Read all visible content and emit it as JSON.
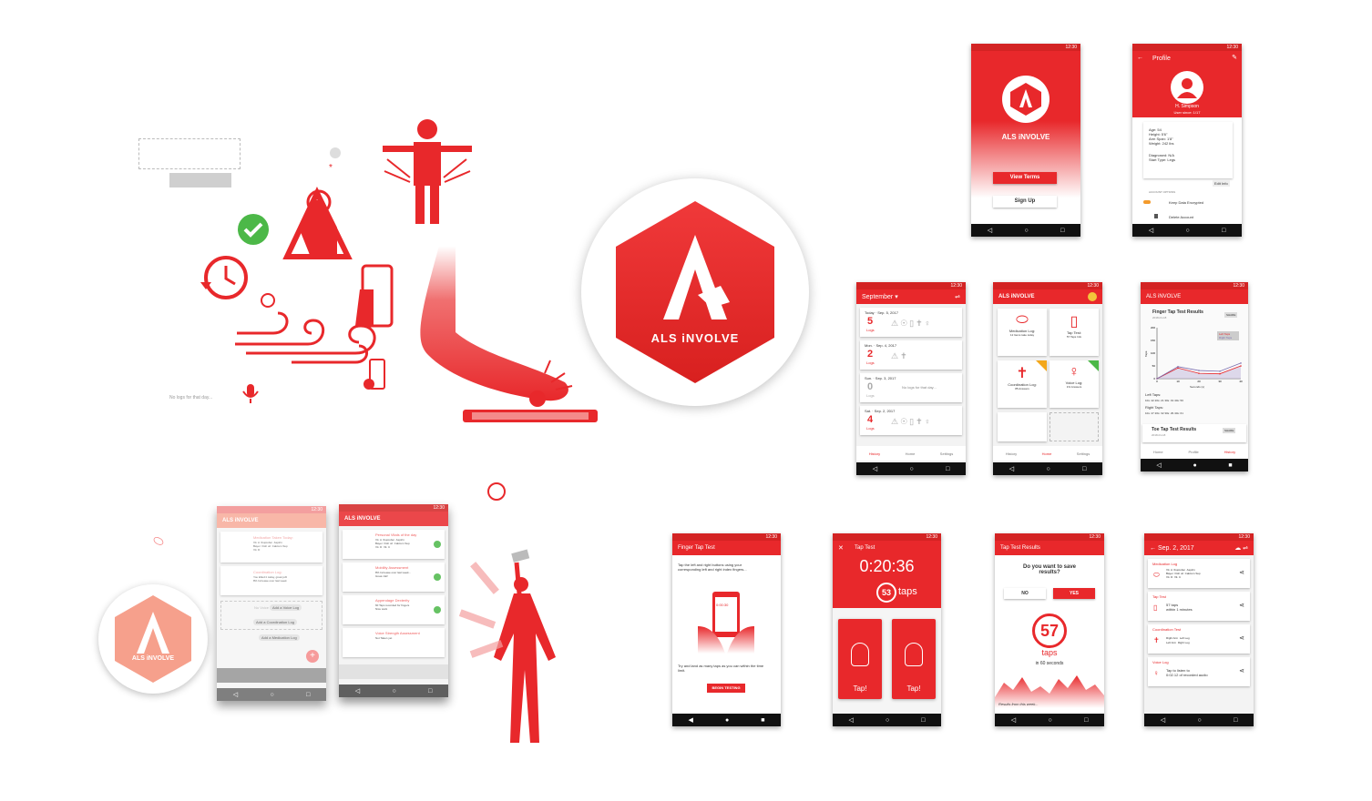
{
  "brand": {
    "name": "ALS iNVOLVE",
    "colors": {
      "primary": "#e8282b",
      "dark": "#c31f22",
      "faded": "#f4a08a"
    }
  },
  "status_time": "12:30",
  "left": {
    "no_logs": "No logs for that day..."
  },
  "splash": {
    "app_name": "ALS iNVOLVE",
    "view_terms": "View Terms",
    "sign_up": "Sign Up"
  },
  "profile": {
    "title": "Profile",
    "name": "H. Simpson",
    "user_since": "User since: 1/17",
    "details": [
      "Age: 54",
      "Height: 5'6\"",
      "Arm Span: 1'8\"",
      "Weight: 242 lbs"
    ],
    "diag": [
      "Diagnosed: N/A",
      "Start Type: Legs"
    ],
    "edit": "Edit Info",
    "account_options": "ACCOUNT OPTIONS",
    "encrypt": "Keep Data Encrypted",
    "delete": "Delete Account"
  },
  "history": {
    "month": "September",
    "days": [
      {
        "date": "Today · Sep. 5, 2017",
        "count": "5",
        "unit": "Logs"
      },
      {
        "date": "Mon. · Sep. 4, 2017",
        "count": "2",
        "unit": "Logs"
      },
      {
        "date": "Sun. · Sep. 3, 2017",
        "count": "0",
        "unit": "Logs",
        "note": "No logs for that day..."
      },
      {
        "date": "Sat. · Sep. 2, 2017",
        "count": "4",
        "unit": "Logs"
      }
    ],
    "nav": [
      "History",
      "Home",
      "Settings"
    ]
  },
  "home": {
    "title": "ALS iNVOLVE",
    "tiles": [
      {
        "label": "Medication Log:",
        "sub": "12 Items take today"
      },
      {
        "label": "Tap Test:",
        "sub": "57 Taps Info"
      },
      {
        "label": "Coordination Log:",
        "sub": "85 Answers"
      },
      {
        "label": "Voice Log:",
        "sub": "1% Answers"
      }
    ],
    "nav": [
      "History",
      "Home",
      "Settings"
    ]
  },
  "results": {
    "header": "ALS iNVOLVE",
    "title": "Finger Tap Test Results",
    "date": "2018-01-18",
    "share": "SHARE",
    "legend": [
      "Left Taps",
      "Right Taps"
    ],
    "xlabel": "Seconds (s)",
    "ylabel": "Taps",
    "left_label": "Left Taps:",
    "left_vals": "10s: 42  20s: 21  30s: 19  40s: 50",
    "right_label": "Right Taps:",
    "right_vals": "10s: 47  20s: 32  30s: 29  40s: 61",
    "toe_title": "Toe Tap Test Results",
    "toe_date": "2018-01-18",
    "nav": [
      "Home",
      "Profile",
      "History"
    ]
  },
  "chart_data": {
    "type": "line",
    "x": [
      0,
      10,
      20,
      30,
      40
    ],
    "xlim": [
      0,
      40
    ],
    "ylim": [
      0,
      200
    ],
    "series": [
      {
        "name": "Left Taps",
        "values": [
          0,
          42,
          21,
          19,
          50
        ]
      },
      {
        "name": "Right Taps",
        "values": [
          0,
          47,
          32,
          29,
          61
        ]
      }
    ]
  },
  "finger": {
    "title": "Finger Tap Test",
    "instructions": "Tap the left and right buttons using your corresponding left and right index fingers...",
    "timer": "0:00:30",
    "more": "Try and land as many taps as you can within the time limit.",
    "begin": "BEGIN TESTING"
  },
  "taptest": {
    "title": "Tap Test",
    "timer": "0:20:36",
    "count": "53",
    "unit": "taps",
    "left": "Tap!",
    "right": "Tap!"
  },
  "tapresults": {
    "title": "Tap Test Results",
    "question": "Do you want to save results?",
    "no": "NO",
    "yes": "YES",
    "count": "57",
    "unit": "taps",
    "time": "in 60 seconds",
    "footer": "Results from this week..."
  },
  "daylog": {
    "title": "Sep. 2, 2017",
    "items": [
      {
        "title": "Medication Log",
        "rows": "Vit. A  Ibuprofen  Aspirin\nBayer  Fish oil  Calcium Sup\nVit. D  Vit. C"
      },
      {
        "title": "Tap Test",
        "rows": "57 taps\nwithin 1 minutes"
      },
      {
        "title": "Coordination Test",
        "rows": "Right Arm  Left Leg\nLeft Arm  Right Leg"
      },
      {
        "title": "Voice Log",
        "rows": "Tap to listen to\n0:02.12 of recorded audio"
      }
    ]
  },
  "faded": {
    "brand": "ALS iNVOLVE",
    "home": {
      "title": "ALS iNVOLVE",
      "items": [
        {
          "title": "Medication Taken Today:",
          "rows": "Vit. A  Ibuprofen  Aspirin\nBayer  Fish oil  Calcium Sup\nVit. D"
        },
        {
          "title": "Coordination Log:",
          "rows": "You killed it today, great job!\n8% Increase over last week"
        },
        {
          "title": "No Voice Log Today",
          "rows": ""
        }
      ],
      "actions": [
        "Add a Voice Log",
        "Add a Coordination Log",
        "Add a Medication Log"
      ]
    },
    "vitals": {
      "title": "ALS iNVOLVE",
      "items": [
        {
          "title": "Personal Vitals of the day",
          "rows": "Vit. A  Ibuprofen  Aspirin\nBayer  Fish oil  Calcium Sup\nVit. D  Vit. C"
        },
        {
          "title": "Mobility Assessment",
          "rows": "8% Increase over last week...\nGreat Job!"
        },
        {
          "title": "Appendage Dexterity",
          "rows": "60 Taps recorded for fingers\nNice work"
        },
        {
          "title": "Voice Strength Assessment",
          "rows": "Not Taken yet"
        }
      ]
    }
  }
}
